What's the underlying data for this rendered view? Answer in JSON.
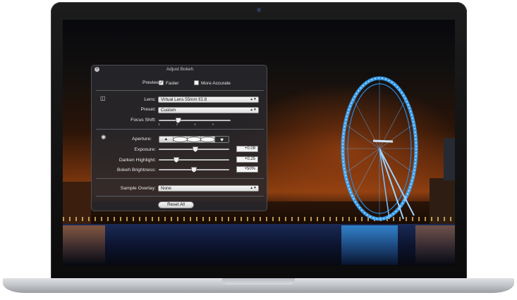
{
  "window_title": "Adjust Bokeh",
  "preview": {
    "label": "Preview:",
    "options": [
      {
        "label": "Faster",
        "checked": true
      },
      {
        "label": "More Accurate",
        "checked": false
      }
    ]
  },
  "lens": {
    "label": "Lens:",
    "value": "Virtual Lens 55mm f/2.8"
  },
  "preset": {
    "label": "Preset:",
    "value": "Custom"
  },
  "focus_shift": {
    "label": "Focus Shift:",
    "level": 0.27
  },
  "aperture": {
    "label": "Aperture:",
    "shapes": [
      "triangle",
      "circle",
      "circle",
      "circle",
      "heart"
    ],
    "selected_index": 4
  },
  "exposure": {
    "label": "Exposure:",
    "value": "+0.09",
    "level": 0.52
  },
  "darken_highlight": {
    "label": "Darken Highlight:",
    "value": "+0.25",
    "level": 0.25
  },
  "bokeh_brightness": {
    "label": "Bokeh Brightness:",
    "value": "+50%",
    "level": 0.5
  },
  "sample_overlay": {
    "label": "Sample Overlay:",
    "value": "None"
  },
  "reset_label": "Reset All",
  "icons": {
    "close": "close-icon",
    "lens": "lens-icon",
    "aperture": "aperture-icon"
  },
  "colors": {
    "wheel": "#3aa8ff",
    "panel_bg": "#28282c"
  }
}
